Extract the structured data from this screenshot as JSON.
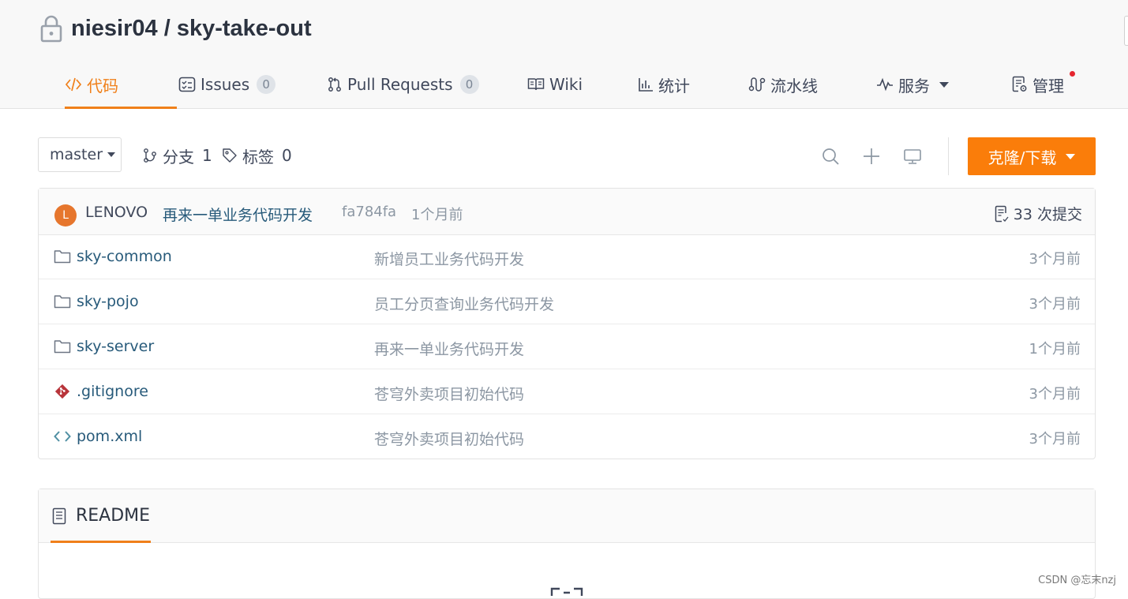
{
  "repo": {
    "owner": "niesir04",
    "separator": " / ",
    "name": "sky-take-out"
  },
  "nav": {
    "tabs": [
      {
        "label": "代码",
        "icon": "code-icon",
        "active": true
      },
      {
        "label": "Issues",
        "icon": "issues-icon",
        "count": "0"
      },
      {
        "label": "Pull Requests",
        "icon": "pull-request-icon",
        "count": "0"
      },
      {
        "label": "Wiki",
        "icon": "book-icon"
      },
      {
        "label": "统计",
        "icon": "bar-chart-icon"
      },
      {
        "label": "流水线",
        "icon": "pipeline-icon"
      },
      {
        "label": "服务",
        "icon": "pulse-icon",
        "has_dropdown": true
      },
      {
        "label": "管理",
        "icon": "settings-doc-icon",
        "notification_dot": true
      }
    ]
  },
  "toolbar": {
    "branch": "master",
    "branches_label": "分支",
    "branches_count": "1",
    "tags_label": "标签",
    "tags_count": "0",
    "clone_label": "克隆/下载"
  },
  "commit": {
    "avatar_letter": "L",
    "author": "LENOVO",
    "message": "再来一单业务代码开发",
    "sha": "fa784fa",
    "time": "1个月前",
    "count_label": "33 次提交"
  },
  "files": [
    {
      "name": "sky-common",
      "type": "folder",
      "commit": "新增员工业务代码开发",
      "time": "3个月前"
    },
    {
      "name": "sky-pojo",
      "type": "folder",
      "commit": "员工分页查询业务代码开发",
      "time": "3个月前"
    },
    {
      "name": "sky-server",
      "type": "folder",
      "commit": "再来一单业务代码开发",
      "time": "1个月前"
    },
    {
      "name": ".gitignore",
      "type": "git",
      "commit": "苍穹外卖项目初始代码",
      "time": "3个月前"
    },
    {
      "name": "pom.xml",
      "type": "code",
      "commit": "苍穹外卖项目初始代码",
      "time": "3个月前"
    }
  ],
  "readme": {
    "title": "README"
  },
  "watermark": "CSDN @忘末nzj",
  "colors": {
    "accent": "#f0801a",
    "clone_button": "#fa7d0a",
    "link": "#275a7a",
    "muted": "#8c97a3",
    "notification": "#e5262f"
  }
}
